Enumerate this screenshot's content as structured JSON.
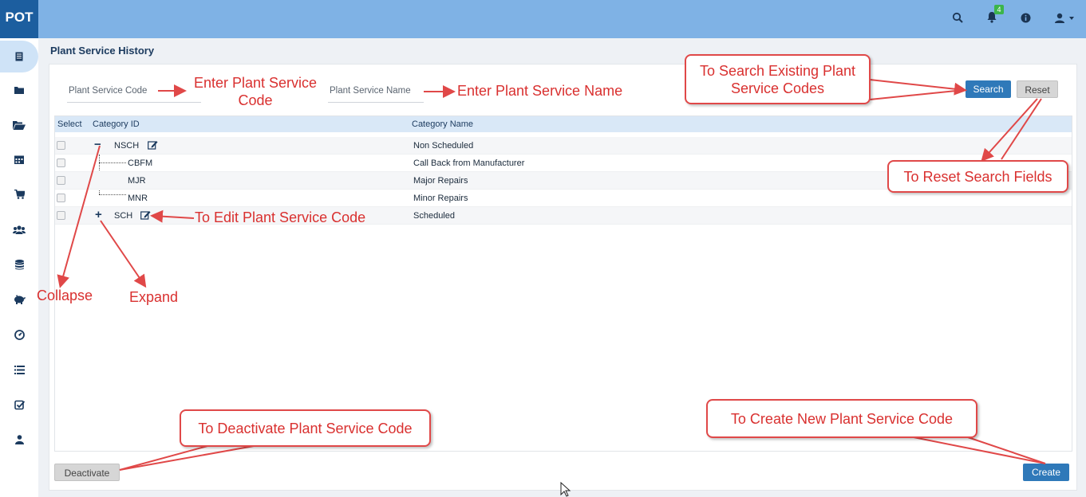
{
  "app": {
    "logo": "POT",
    "notification_count": "4"
  },
  "topbar": {
    "icons": [
      "search-icon",
      "bell-icon",
      "info-icon",
      "user-icon"
    ]
  },
  "sidebar": {
    "icons": [
      "document-icon",
      "folder-icon",
      "folder-open-icon",
      "calendar-icon",
      "cart-icon",
      "users-icon",
      "database-icon",
      "piggy-bank-icon",
      "gauge-icon",
      "list-icon",
      "checklist-icon",
      "user-icon"
    ]
  },
  "page": {
    "title": "Plant Service History"
  },
  "search": {
    "code_label": "Plant Service Code",
    "name_label": "Plant Service Name",
    "search_label": "Search",
    "reset_label": "Reset"
  },
  "grid": {
    "headers": {
      "select": "Select",
      "category_id": "Category ID",
      "category_name": "Category Name"
    },
    "rows": [
      {
        "code": "NSCH",
        "name": "Non Scheduled",
        "toggle": "−",
        "level": 0
      },
      {
        "code": "CBFM",
        "name": "Call Back from Manufacturer",
        "level": 1
      },
      {
        "code": "MJR",
        "name": "Major Repairs",
        "level": 1
      },
      {
        "code": "MNR",
        "name": "Minor Repairs",
        "level": 1
      },
      {
        "code": "SCH",
        "name": "Scheduled",
        "toggle": "+",
        "level": 0
      }
    ]
  },
  "actions": {
    "deactivate_label": "Deactivate",
    "create_label": "Create"
  },
  "annotations": {
    "enter_code": "Enter Plant Service Code",
    "enter_name": "Enter Plant Service Name",
    "search_hint": "To Search Existing Plant Service Codes",
    "reset_hint": "To Reset Search Fields",
    "edit_hint": "To Edit Plant Service Code",
    "collapse": "Collapse",
    "expand": "Expand",
    "deactivate_hint": "To Deactivate Plant Service Code",
    "create_hint": "To Create New Plant Service Code"
  },
  "colors": {
    "topbar": "#7fb2e5",
    "logo_bg": "#1c5e9f",
    "primary": "#2f79b9",
    "annotation": "#d9302f",
    "badge": "#3cb54a"
  }
}
